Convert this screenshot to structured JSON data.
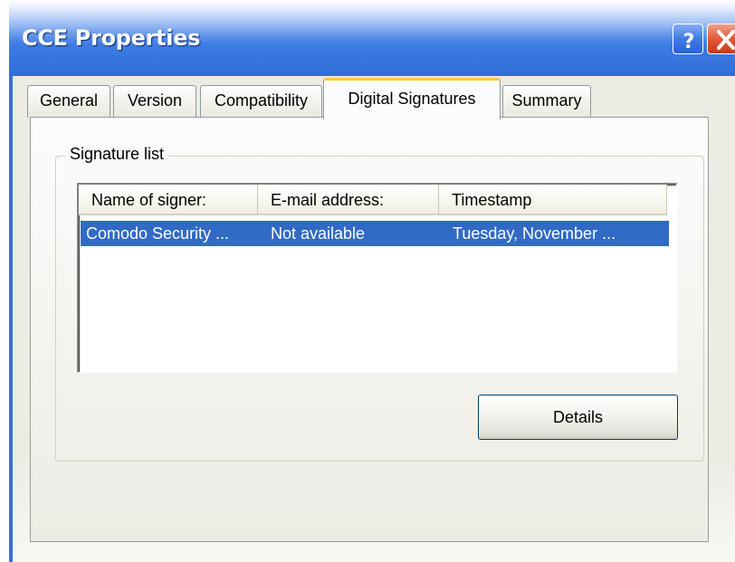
{
  "window": {
    "title": "CCE Properties"
  },
  "tabs": [
    {
      "label": "General",
      "active": false
    },
    {
      "label": "Version",
      "active": false
    },
    {
      "label": "Compatibility",
      "active": false
    },
    {
      "label": "Digital Signatures",
      "active": true
    },
    {
      "label": "Summary",
      "active": false
    }
  ],
  "signature_group": {
    "label": "Signature list",
    "columns": [
      "Name of signer:",
      "E-mail address:",
      "Timestamp"
    ],
    "rows": [
      {
        "name": "Comodo Security ...",
        "email": "Not available",
        "timestamp": "Tuesday, November ...",
        "selected": true
      }
    ]
  },
  "buttons": {
    "details": "Details"
  },
  "colors": {
    "titlebar": "#3678df",
    "selection": "#316ac5",
    "active_tab_accent": "#ffc83c",
    "close_button": "#e2593a"
  }
}
